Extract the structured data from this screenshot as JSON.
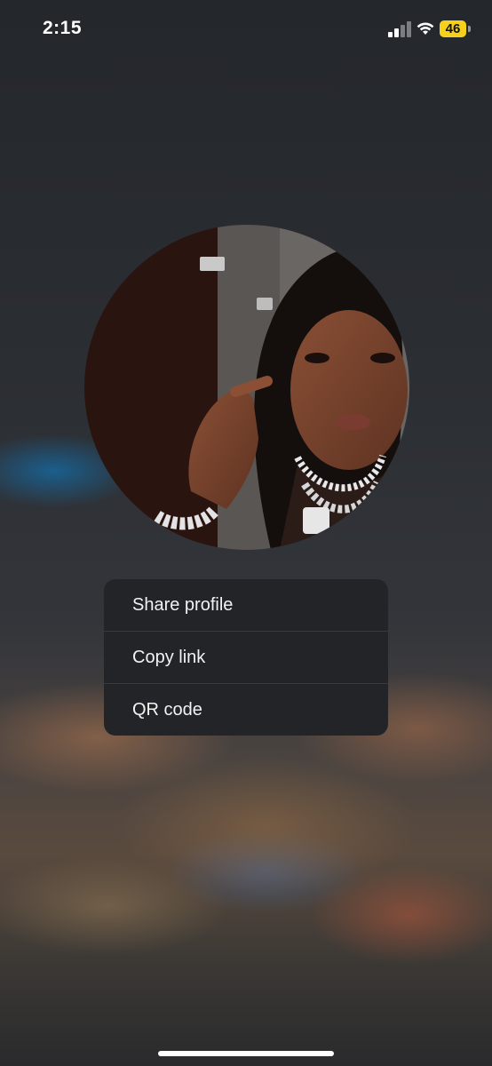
{
  "status_bar": {
    "time": "2:15",
    "battery_level": "46",
    "battery_color": "#f6d11c",
    "icons": [
      "signal-icon",
      "wifi-icon",
      "battery-icon"
    ]
  },
  "profile": {
    "avatar": "profile-photo"
  },
  "menu": {
    "items": [
      {
        "label": "Share profile"
      },
      {
        "label": "Copy link"
      },
      {
        "label": "QR code"
      }
    ]
  }
}
